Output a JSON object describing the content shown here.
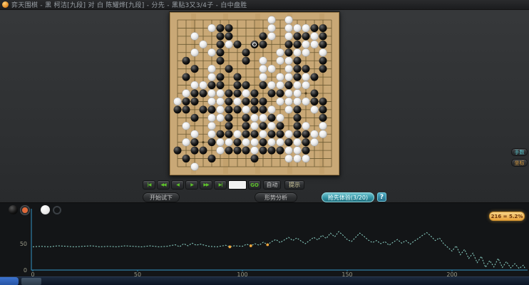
{
  "window": {
    "icon": "app-logo-icon",
    "title": "弈天围棋 - 黑 柯洁[九段] 对 白 陈耀烨[九段] - 分先 - 黑贴3又3/4子 - 白中盘胜"
  },
  "board": {
    "size": 19,
    "wood_color": "#c9a876",
    "line_color": "#6b5a33",
    "grid": [
      "...........W.W.....",
      "....WBB....W.WWWBB.",
      "..W..BB...BW.WBBWB.",
      "...W.BWB.BB..BBWWB.",
      "..W.WB..B...WBWW.W.",
      ".B...B..B.W.WWB..B.",
      "..B.W.B...WW.WBB.B.",
      ".B..WB.B..W.WWBWB..",
      "..WWBB.BB.BWWBWW...",
      ".WBBWWBBWB.BBWW.B..",
      "WBB.WWBWBBB.WWWWBB.",
      "BB.BBWBBWBBW.WB.WB.",
      "..B.WWB.BWWBW.B..B.",
      ".W..W.B.BWBWB.BW.W.",
      "..W.WBBWBBWBBWBBWW.",
      ".WB.BWWBWWBWWBWBW..",
      "B.BB.WBBBWBBBWWB...",
      ".B..B....B...WWW...",
      "..W................"
    ],
    "current_move": {
      "row": 4,
      "col": 10
    }
  },
  "controls": {
    "nav": [
      {
        "name": "first-move",
        "glyph": "|◀"
      },
      {
        "name": "back-fast",
        "glyph": "◀◀"
      },
      {
        "name": "back-one",
        "glyph": "◀"
      },
      {
        "name": "forward-one",
        "glyph": "▶"
      },
      {
        "name": "forward-fast",
        "glyph": "▶▶"
      },
      {
        "name": "last-move",
        "glyph": "▶|"
      }
    ],
    "move_input_value": "",
    "go_label": "GO",
    "auto_label": "自动",
    "hint_label": "提示",
    "trial_label": "开始试下",
    "analysis_label": "形势分析",
    "ai_quota_label": "抢先体验(3/20)",
    "help_label": "?"
  },
  "side_buttons": [
    {
      "name": "move-numbers-toggle",
      "label": "手数"
    },
    {
      "name": "coordinates-toggle",
      "label": "坐标"
    }
  ],
  "graph": {
    "legend": [
      {
        "stone": "black",
        "selected": true
      },
      {
        "stone": "white",
        "selected": false
      }
    ],
    "tooltip": "216 = 5.2%"
  },
  "chart_data": {
    "type": "line",
    "title": "",
    "xlabel": "",
    "ylabel": "",
    "x_ticks": [
      0,
      50,
      100,
      150,
      200
    ],
    "y_ticks": [
      0,
      50
    ],
    "xlim": [
      0,
      235
    ],
    "ylim": [
      0,
      115
    ],
    "grid": false,
    "axis_color": "#2e7fa6",
    "line_color": "#8fd9cc",
    "marker_color": "#f2a73d",
    "series": [
      {
        "name": "black-win-rate-percent",
        "points": [
          [
            0,
            44
          ],
          [
            4,
            45
          ],
          [
            8,
            44
          ],
          [
            12,
            46
          ],
          [
            16,
            45
          ],
          [
            20,
            44
          ],
          [
            24,
            45
          ],
          [
            28,
            46
          ],
          [
            32,
            44
          ],
          [
            36,
            45
          ],
          [
            40,
            44
          ],
          [
            44,
            46
          ],
          [
            48,
            45
          ],
          [
            52,
            44
          ],
          [
            56,
            46
          ],
          [
            60,
            44
          ],
          [
            64,
            45
          ],
          [
            68,
            48
          ],
          [
            70,
            44
          ],
          [
            72,
            50
          ],
          [
            74,
            46
          ],
          [
            76,
            51
          ],
          [
            78,
            47
          ],
          [
            80,
            49
          ],
          [
            84,
            45
          ],
          [
            88,
            44
          ],
          [
            92,
            47
          ],
          [
            94,
            44
          ],
          [
            96,
            46
          ],
          [
            100,
            45
          ],
          [
            102,
            49
          ],
          [
            104,
            46
          ],
          [
            106,
            50
          ],
          [
            108,
            47
          ],
          [
            110,
            53
          ],
          [
            112,
            48
          ],
          [
            114,
            54
          ],
          [
            116,
            58
          ],
          [
            118,
            52
          ],
          [
            120,
            57
          ],
          [
            122,
            62
          ],
          [
            124,
            56
          ],
          [
            126,
            61
          ],
          [
            128,
            55
          ],
          [
            130,
            50
          ],
          [
            132,
            56
          ],
          [
            134,
            62
          ],
          [
            136,
            57
          ],
          [
            138,
            66
          ],
          [
            140,
            60
          ],
          [
            142,
            70
          ],
          [
            144,
            63
          ],
          [
            146,
            73
          ],
          [
            148,
            66
          ],
          [
            150,
            58
          ],
          [
            152,
            54
          ],
          [
            154,
            62
          ],
          [
            156,
            70
          ],
          [
            158,
            64
          ],
          [
            160,
            57
          ],
          [
            162,
            52
          ],
          [
            164,
            56
          ],
          [
            166,
            50
          ],
          [
            168,
            54
          ],
          [
            170,
            47
          ],
          [
            172,
            53
          ],
          [
            174,
            58
          ],
          [
            176,
            51
          ],
          [
            178,
            56
          ],
          [
            180,
            49
          ],
          [
            182,
            55
          ],
          [
            184,
            60
          ],
          [
            186,
            66
          ],
          [
            188,
            71
          ],
          [
            190,
            64
          ],
          [
            192,
            56
          ],
          [
            194,
            61
          ],
          [
            196,
            50
          ],
          [
            198,
            43
          ],
          [
            200,
            36
          ],
          [
            202,
            46
          ],
          [
            204,
            29
          ],
          [
            206,
            39
          ],
          [
            208,
            22
          ],
          [
            210,
            32
          ],
          [
            212,
            14
          ],
          [
            214,
            26
          ],
          [
            216,
            5.2
          ],
          [
            218,
            18
          ],
          [
            220,
            6
          ],
          [
            222,
            22
          ],
          [
            224,
            5
          ],
          [
            226,
            16
          ],
          [
            228,
            4
          ],
          [
            230,
            12
          ],
          [
            232,
            3
          ],
          [
            234,
            9
          ],
          [
            235,
            2
          ]
        ]
      }
    ],
    "marked_points": [
      [
        94,
        44
      ],
      [
        104,
        46
      ],
      [
        112,
        48
      ]
    ],
    "tooltip": "216 = 5.2%"
  },
  "taskbar": {
    "items": [
      {
        "name": "start-button"
      },
      {
        "name": "taskbar-app"
      }
    ]
  }
}
